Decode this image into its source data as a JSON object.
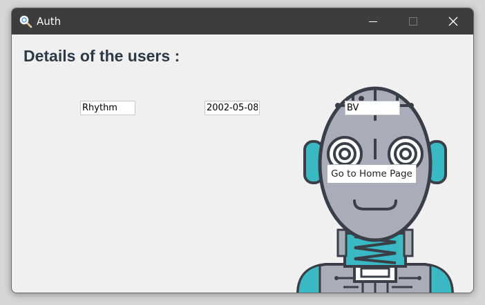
{
  "window": {
    "title": "Auth",
    "controls": {
      "minimize": "minimize-icon",
      "maximize": "maximize-icon",
      "close": "close-icon"
    }
  },
  "main": {
    "heading": "Details of the users :",
    "fields": {
      "name": "Rhythm",
      "dob": "2002-05-08",
      "initials": "BV"
    },
    "home_button_label": "Go to Home Page",
    "image": "robot-illustration"
  },
  "colors": {
    "titlebar": "#3d3d3d",
    "background": "#f0f0f0",
    "heading": "#2d3a46",
    "robot_teal": "#3ab8c4",
    "robot_gray": "#a9adb9",
    "robot_outline": "#3a3f47"
  }
}
